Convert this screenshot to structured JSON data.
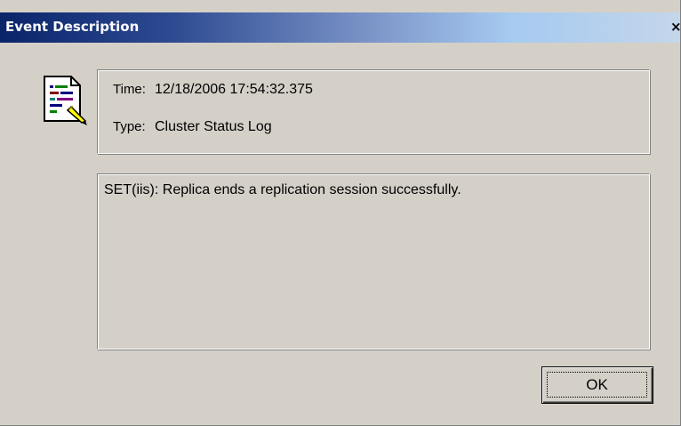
{
  "window": {
    "title": "Event Description",
    "close_glyph": "×"
  },
  "event": {
    "time_label": "Time:",
    "time_value": "12/18/2006 17:54:32.375",
    "type_label": "Type:",
    "type_value": "Cluster Status Log"
  },
  "description": {
    "text": "SET(iis): Replica ends a replication session successfully."
  },
  "buttons": {
    "ok_label": "OK"
  },
  "icons": {
    "event_icon": "document-pencil-icon"
  },
  "colors": {
    "title_gradient_start": "#0a246a",
    "title_gradient_end": "#a6caf0",
    "dialog_face": "#d4d0c8"
  }
}
